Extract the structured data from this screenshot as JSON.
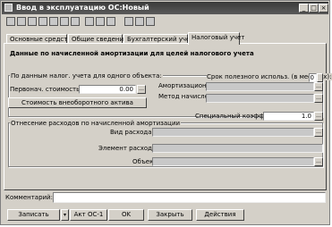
{
  "window": {
    "title": "Ввод в эксплуатацию ОС:Новый",
    "controls": [
      "_",
      "□",
      "×"
    ]
  },
  "toolbar": {
    "icons": [
      "copy-icon",
      "list-icon",
      "table-icon",
      "doc-icon",
      "structure-icon",
      "movement-icon",
      "filter-icon",
      "report-icon",
      "arrow-down-icon",
      "arrow-up-icon",
      "reload-icon",
      "help-icon",
      "pointer-help-icon"
    ]
  },
  "tabs": [
    "Основные средства",
    "Общие сведения",
    "Бухгалтерский учет",
    "Налоговый учет"
  ],
  "active_tab": "Налоговый учет",
  "section": {
    "heading": "Данные по начисленной амортизации для целей налогового учета",
    "group1": {
      "title": "По данным налог. учета для одного объекта:",
      "initial_cost_label": "Первонач. стоимость:",
      "initial_cost_value": "0.00",
      "button_label": "Стоимость внеоборотного актива",
      "useful_life_label": "Срок полезного использ. (в месяцах):",
      "useful_life_value": "0",
      "amort_group_label": "Амортизационная группа:",
      "method_label": "Метод начисления амортизации:",
      "coef_label": "Специальный коэффициент:",
      "coef_value": "1.0"
    },
    "group2": {
      "title": "Отнесение расходов по начисленной амортизации",
      "expense_type_label": "Вид расхода:",
      "expense_element_label": "Элемент расхода:",
      "object_label": "Объект:"
    }
  },
  "comment_label": "Комментарий:",
  "buttons": {
    "record": "Записать",
    "act": "Акт ОС-1",
    "ok": "OK",
    "close": "Закрыть",
    "actions": "Действия"
  }
}
